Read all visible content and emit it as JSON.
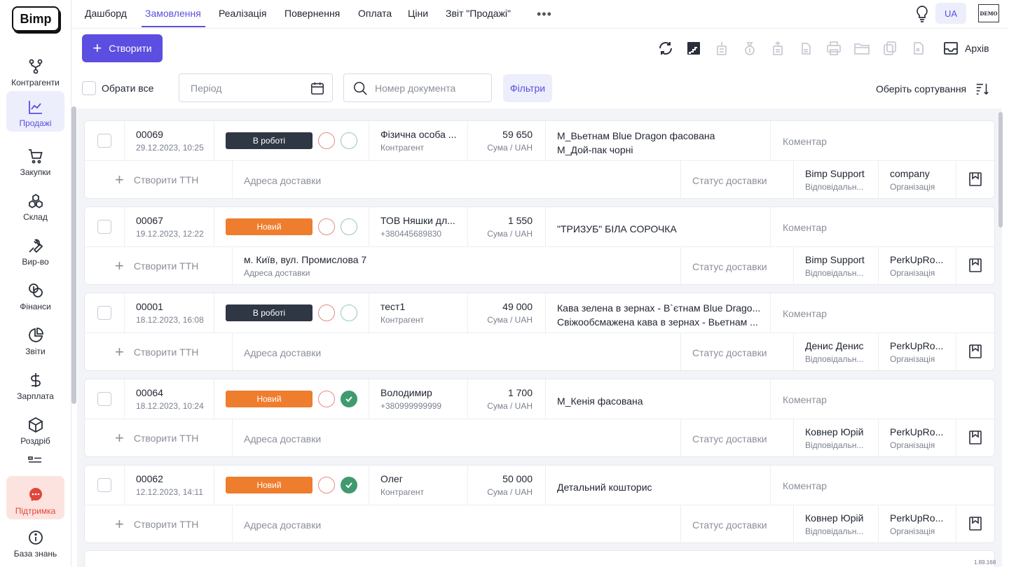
{
  "app": {
    "logo": "Bimp",
    "lang": "UA",
    "demo": "DEMO",
    "version": "1.89.168"
  },
  "sidebar": {
    "items": [
      {
        "label": "Контрагенти",
        "icon": "branch-icon"
      },
      {
        "label": "Продажі",
        "icon": "chart-line-icon"
      },
      {
        "label": "Закупки",
        "icon": "cart-icon"
      },
      {
        "label": "Склад",
        "icon": "boxes-icon"
      },
      {
        "label": "Вир-во",
        "icon": "wrench-icon"
      },
      {
        "label": "Фінанси",
        "icon": "coins-icon"
      },
      {
        "label": "Звіти",
        "icon": "pie-chart-icon"
      },
      {
        "label": "Зарплата",
        "icon": "dollar-icon"
      },
      {
        "label": "Роздріб",
        "icon": "cube-icon"
      },
      {
        "label": "Підтримка",
        "icon": "chat-icon"
      },
      {
        "label": "База знань",
        "icon": "info-icon"
      }
    ]
  },
  "tabs": [
    "Дашборд",
    "Замовлення",
    "Реалізація",
    "Повернення",
    "Оплата",
    "Ціни",
    "Звіт \"Продажі\""
  ],
  "toolbar": {
    "create_label": "Створити",
    "archive_label": "Архів"
  },
  "filters": {
    "select_all": "Обрати все",
    "period_placeholder": "Період",
    "doc_placeholder": "Номер документа",
    "filters_label": "Фільтри",
    "sort_label": "Оберіть сортування"
  },
  "labels": {
    "sum": "Сума / UAH",
    "comment": "Коментар",
    "create_ttn": "Створити ТТН",
    "delivery_address": "Адреса доставки",
    "delivery_status": "Статус доставки",
    "responsible": "Відповідальн...",
    "organization": "Організація"
  },
  "colors": {
    "accent": "#5b4ee0",
    "status_work": "#2f3744",
    "status_new": "#ef7d2e",
    "ok": "#3f9a6e"
  },
  "orders": [
    {
      "num": "00069",
      "date": "29.12.2023, 10:25",
      "status": "В роботі",
      "status_kind": "work",
      "paid": false,
      "cp": "Фізична особа ...",
      "cp_sub": "Контрагент",
      "sum": "59 650",
      "goods": [
        "М_Вьетнам Blue Dragon фасована",
        "М_Дой-пак чорні"
      ],
      "address": "",
      "resp": "Bimp Support",
      "org": "company"
    },
    {
      "num": "00067",
      "date": "19.12.2023, 12:22",
      "status": "Новий",
      "status_kind": "new",
      "paid": false,
      "cp": "ТОВ Няшки дл...",
      "cp_sub": "+380445689830",
      "sum": "1 550",
      "goods": [
        "\"ТРИЗУБ\" БІЛА СОРОЧКА"
      ],
      "address": "м. Київ, вул. Промислова 7",
      "resp": "Bimp Support",
      "org": "PerkUpRo..."
    },
    {
      "num": "00001",
      "date": "18.12.2023, 16:08",
      "status": "В роботі",
      "status_kind": "work",
      "paid": false,
      "cp": "тест1",
      "cp_sub": "Контрагент",
      "sum": "49 000",
      "goods": [
        "Кава зелена в зернах - В`єтнам Blue Drago...",
        "Свіжообсмажена кава в зернах - Вьетнам ..."
      ],
      "address": "",
      "resp": "Денис Денис",
      "org": "PerkUpRo..."
    },
    {
      "num": "00064",
      "date": "18.12.2023, 10:24",
      "status": "Новий",
      "status_kind": "new",
      "paid": true,
      "cp": "Володимир",
      "cp_sub": "+380999999999",
      "sum": "1 700",
      "goods": [
        "М_Кенія фасована"
      ],
      "address": "",
      "resp": "Ковнер Юрій",
      "org": "PerkUpRo..."
    },
    {
      "num": "00062",
      "date": "12.12.2023, 14:11",
      "status": "Новий",
      "status_kind": "new",
      "paid": true,
      "cp": "Олег",
      "cp_sub": "Контрагент",
      "sum": "50 000",
      "goods": [
        "Детальний кошторис"
      ],
      "address": "",
      "resp": "Ковнер Юрій",
      "org": "PerkUpRo..."
    }
  ]
}
